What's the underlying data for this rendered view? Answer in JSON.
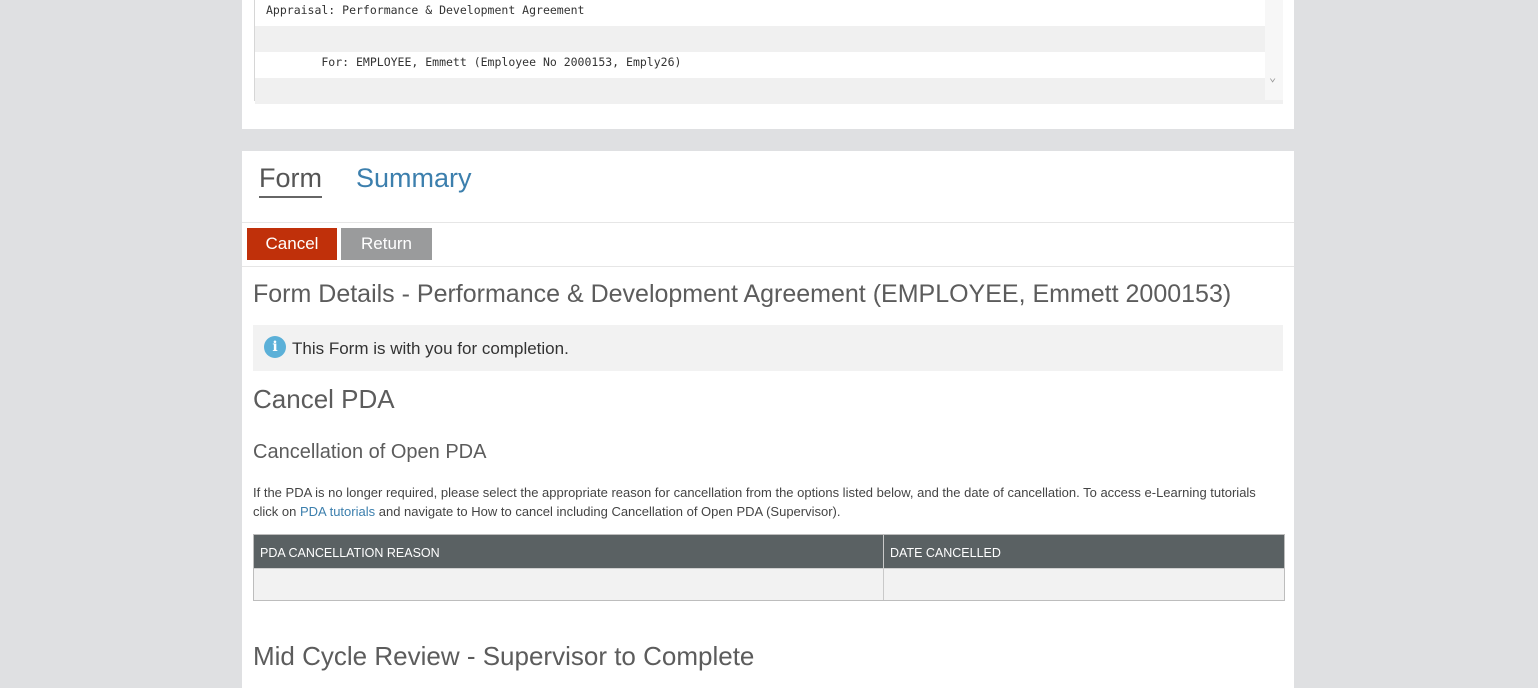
{
  "report": {
    "line1": "Appraisal: Performance & Development Agreement",
    "line2": "",
    "line3": "        For: EMPLOYEE, Emmett (Employee No 2000153, Emply26)",
    "line4": ""
  },
  "tabs": {
    "form": "Form",
    "summary": "Summary"
  },
  "buttons": {
    "cancel": "Cancel",
    "return": "Return"
  },
  "form_title": "Form Details - Performance & Development Agreement (EMPLOYEE, Emmett 2000153)",
  "info": {
    "icon": "info-icon",
    "text": "This Form is with you for completion."
  },
  "section_cancel": "Cancel PDA",
  "subsection_open": "Cancellation of Open PDA",
  "paragraph": {
    "before_link": "If the PDA is no longer required, please select the appropriate reason for cancellation from the options listed below, and the date of cancellation. To access e-Learning tutorials click on ",
    "link": "PDA tutorials",
    "after_link": " and navigate to How to cancel including Cancellation of Open PDA (Supervisor)."
  },
  "table": {
    "columns": [
      "PDA CANCELLATION REASON",
      "DATE CANCELLED"
    ],
    "rows": [
      [
        "",
        ""
      ]
    ]
  },
  "section_mid": "Mid Cycle Review - Supervisor to Complete",
  "colors": {
    "cancel_btn": "#c0300a",
    "return_btn": "#9a9b9c",
    "link": "#3c7fad",
    "table_header": "#5a6163"
  }
}
